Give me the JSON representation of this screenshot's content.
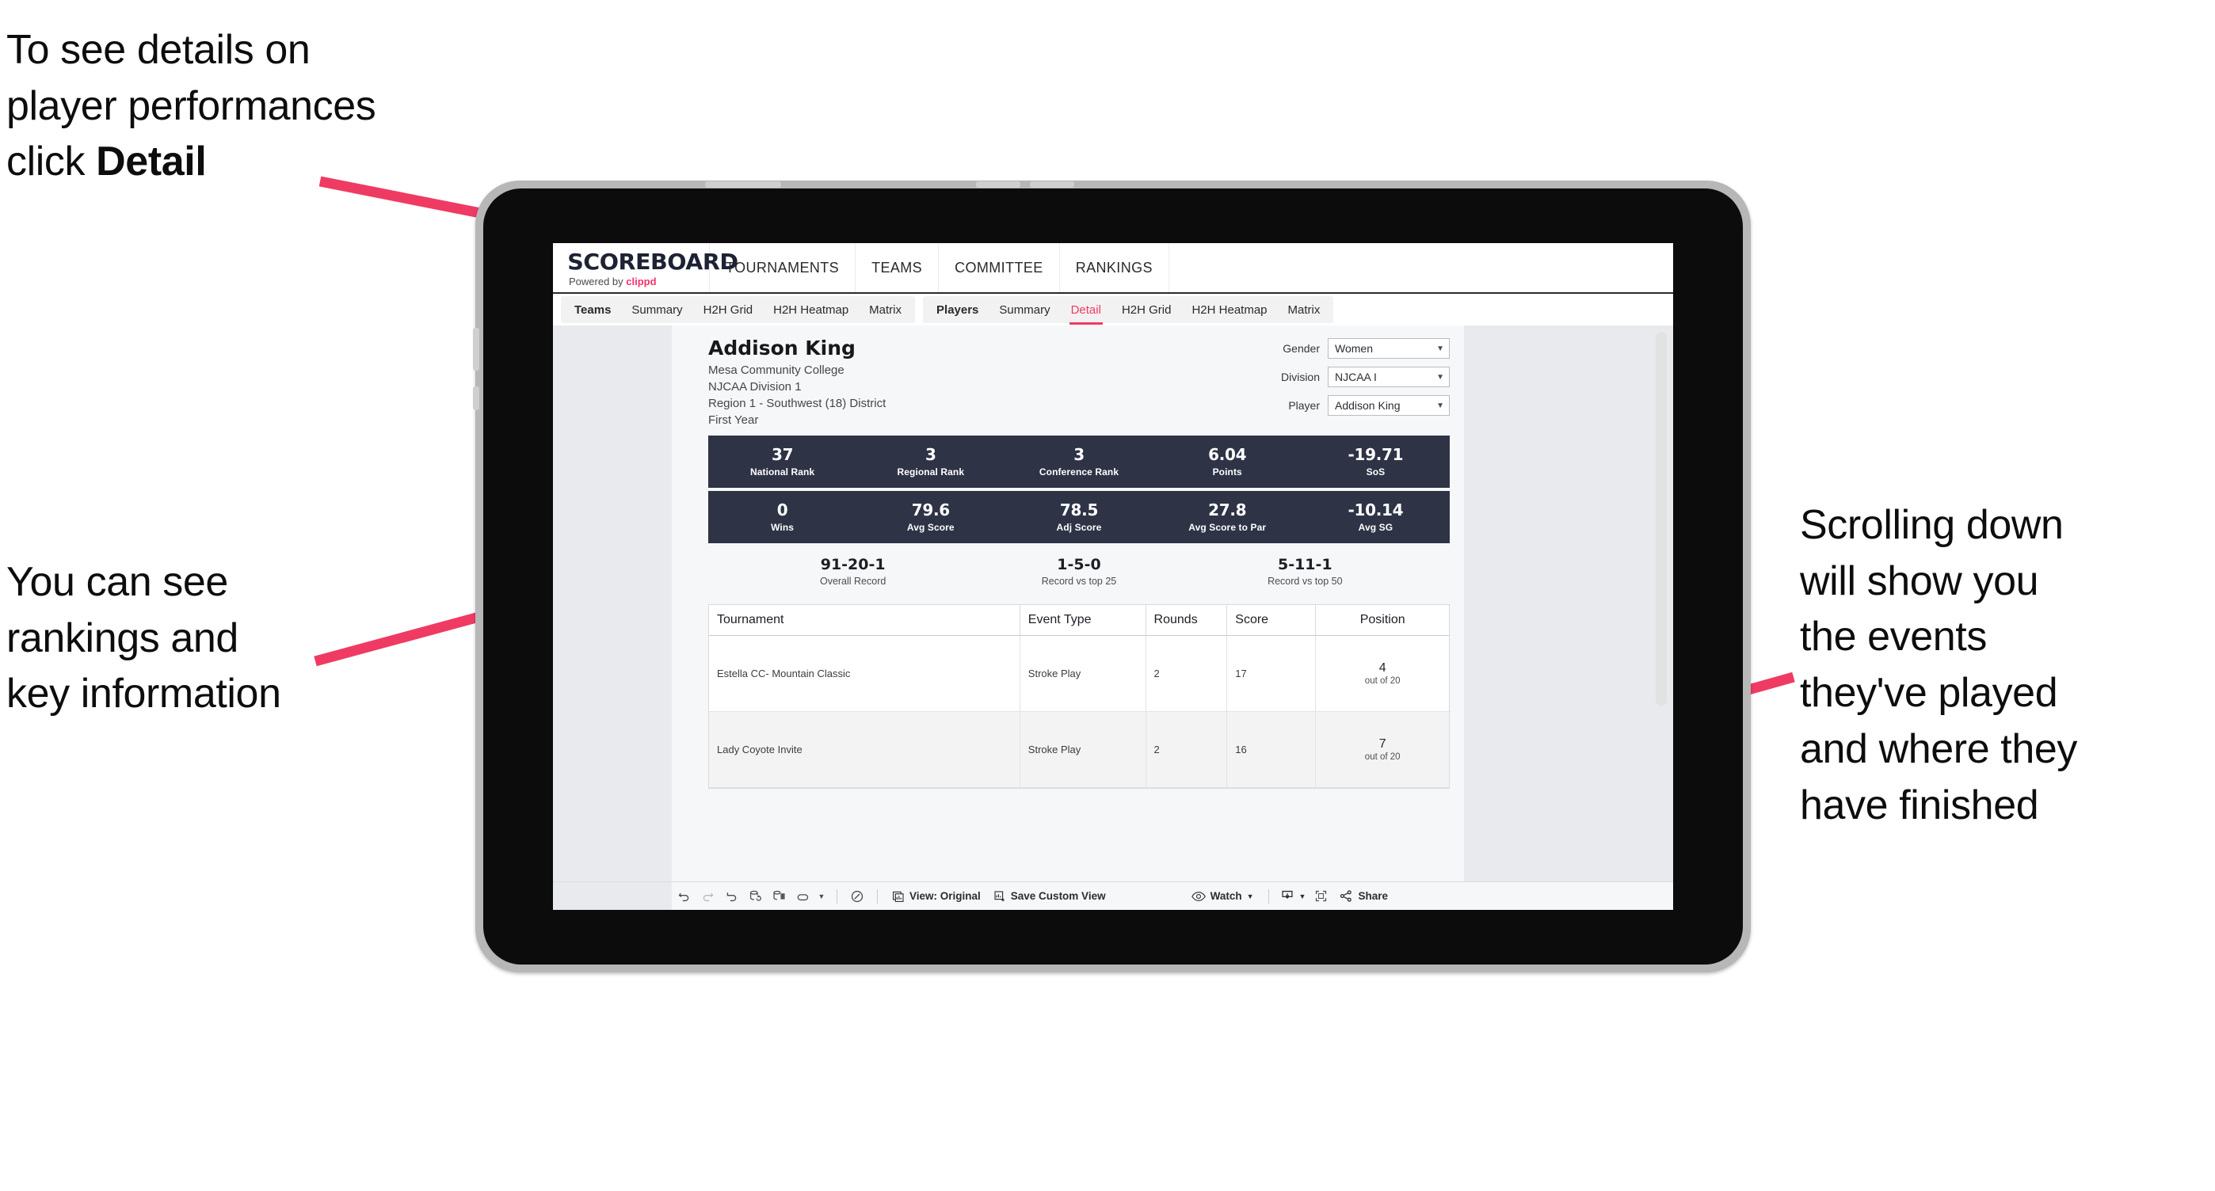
{
  "annotations": {
    "top_left": "To see details on\nplayer performances\nclick ",
    "top_left_bold": "Detail",
    "mid_left": "You can see\nrankings and\nkey information",
    "right": "Scrolling down\nwill show you\nthe events\nthey've played\nand where they\nhave finished"
  },
  "app": {
    "logo_word": "SCOREBOARD",
    "logo_sub_prefix": "Powered by ",
    "logo_sub_brand": "clippd",
    "top_nav": [
      "TOURNAMENTS",
      "TEAMS",
      "COMMITTEE",
      "RANKINGS"
    ],
    "tabs_group_1": [
      "Teams",
      "Summary",
      "H2H Grid",
      "H2H Heatmap",
      "Matrix"
    ],
    "tabs_group_2": [
      "Players",
      "Summary",
      "Detail",
      "H2H Grid",
      "H2H Heatmap",
      "Matrix"
    ],
    "active_tab": "Detail",
    "accent_color": "#ef3b63",
    "navy_color": "#2e3346"
  },
  "player": {
    "name": "Addison King",
    "school": "Mesa Community College",
    "division": "NJCAA Division 1",
    "region": "Region 1 - Southwest (18) District",
    "year": "First Year"
  },
  "selectors": [
    {
      "label": "Gender",
      "value": "Women"
    },
    {
      "label": "Division",
      "value": "NJCAA I"
    },
    {
      "label": "Player",
      "value": "Addison King"
    }
  ],
  "stats_row_1": [
    {
      "value": "37",
      "label": "National Rank"
    },
    {
      "value": "3",
      "label": "Regional Rank"
    },
    {
      "value": "3",
      "label": "Conference Rank"
    },
    {
      "value": "6.04",
      "label": "Points"
    },
    {
      "value": "-19.71",
      "label": "SoS"
    }
  ],
  "stats_row_2": [
    {
      "value": "0",
      "label": "Wins"
    },
    {
      "value": "79.6",
      "label": "Avg Score"
    },
    {
      "value": "78.5",
      "label": "Adj Score"
    },
    {
      "value": "27.8",
      "label": "Avg Score to Par"
    },
    {
      "value": "-10.14",
      "label": "Avg SG"
    }
  ],
  "records": [
    {
      "value": "91-20-1",
      "label": "Overall Record"
    },
    {
      "value": "1-5-0",
      "label": "Record vs top 25"
    },
    {
      "value": "5-11-1",
      "label": "Record vs top 50"
    }
  ],
  "table": {
    "headers": [
      "Tournament",
      "Event Type",
      "Rounds",
      "Score",
      "Position"
    ],
    "rows": [
      {
        "tournament": "Estella CC- Mountain Classic",
        "event_type": "Stroke Play",
        "rounds": "2",
        "score": "17",
        "position": "4",
        "position_of": "out of 20"
      },
      {
        "tournament": "Lady Coyote Invite",
        "event_type": "Stroke Play",
        "rounds": "2",
        "score": "16",
        "position": "7",
        "position_of": "out of 20"
      }
    ]
  },
  "toolbar": {
    "view_label": "View: Original",
    "save_label": "Save Custom View",
    "watch_label": "Watch",
    "share_label": "Share"
  }
}
